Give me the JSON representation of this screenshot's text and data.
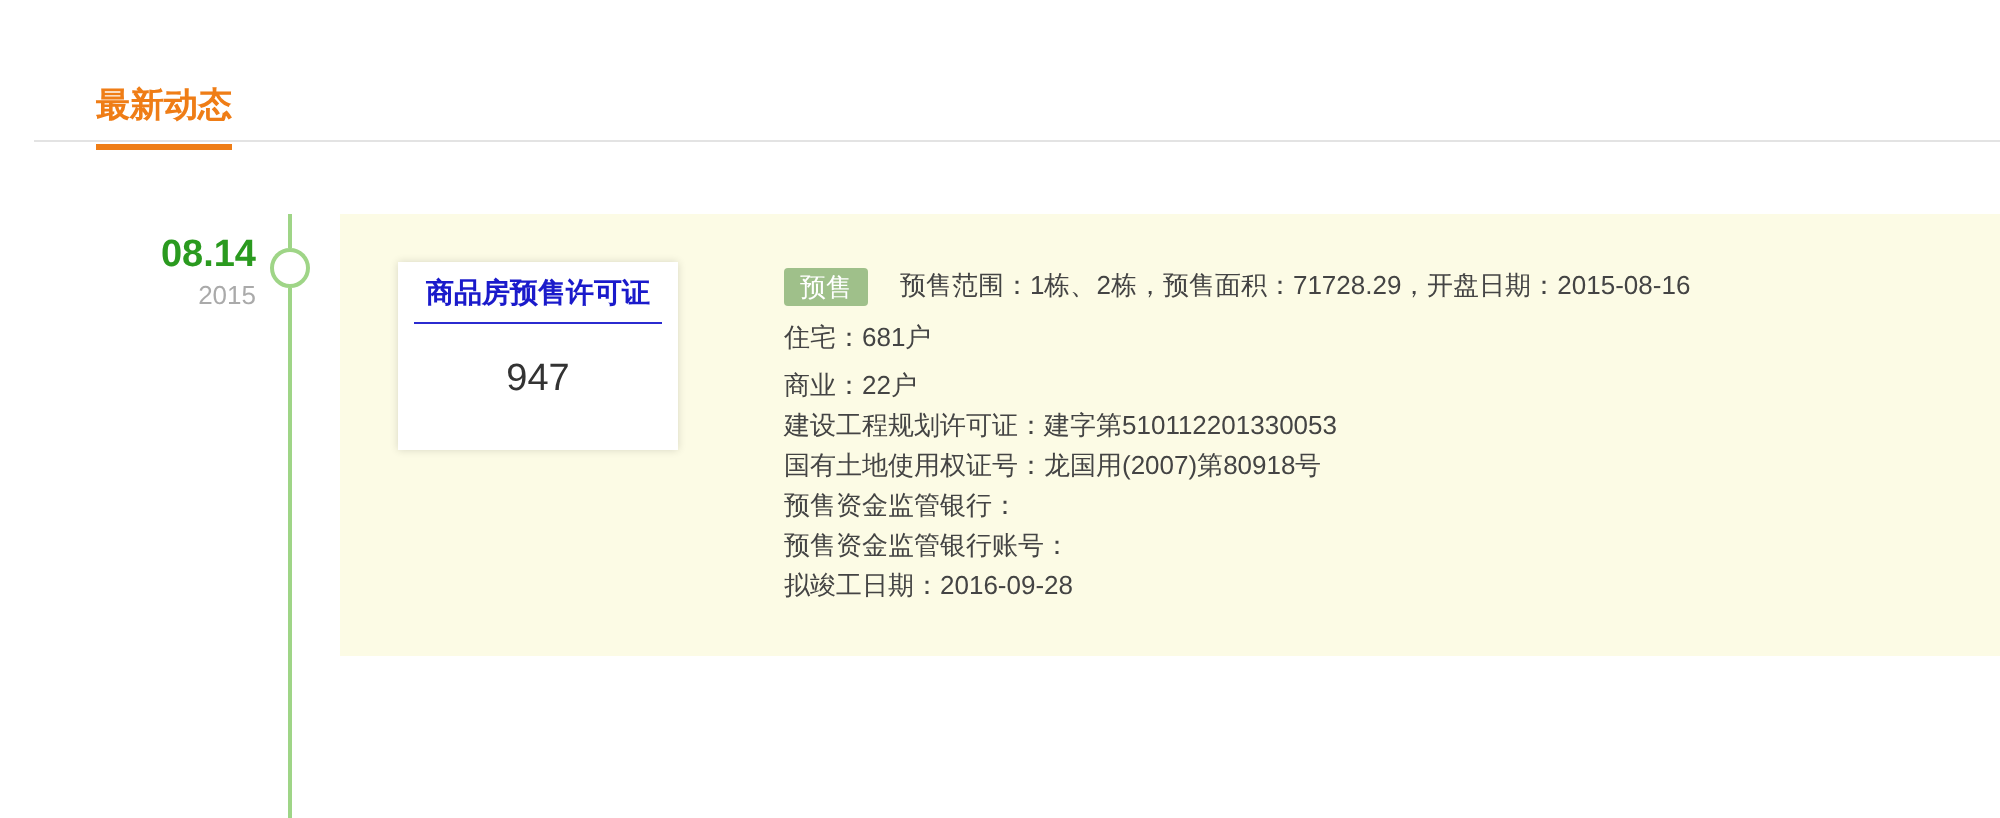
{
  "tabs": [
    {
      "label": "最新动态",
      "selected": true
    }
  ],
  "timeline": [
    {
      "date": "08.14",
      "year": "2015",
      "certificate": {
        "title": "商品房预售许可证",
        "number": "947"
      },
      "badge": "预售",
      "summary": "预售范围：1栋、2栋，预售面积：71728.29，开盘日期：2015-08-16",
      "details": [
        "住宅：681户",
        "商业：22户",
        "建设工程规划许可证：建字第510112201330053",
        "国有土地使用权证号：龙国用(2007)第80918号",
        "预售资金监管银行：",
        "预售资金监管银行账号：",
        "拟竣工日期：2016-09-28"
      ]
    }
  ]
}
